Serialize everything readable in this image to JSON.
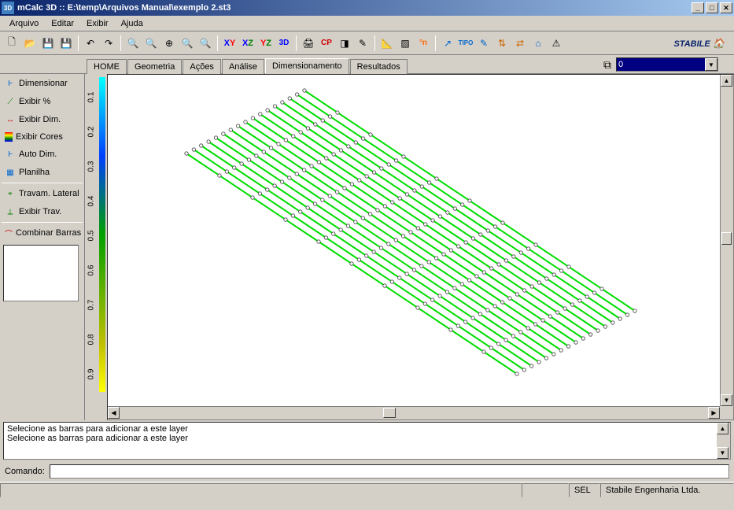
{
  "title": "mCalc 3D :: E:\\temp\\Arquivos Manual\\exemplo 2.st3",
  "menu": {
    "arquivo": "Arquivo",
    "editar": "Editar",
    "exibir": "Exibir",
    "ajuda": "Ajuda"
  },
  "view_buttons": {
    "xy": "XY",
    "xz": "XZ",
    "yz": "YZ",
    "3d": "3D",
    "cp": "CP",
    "n": "°n",
    "tipo": "TIPO"
  },
  "brand": "STABILE",
  "tabs": {
    "home": "HOME",
    "geometria": "Geometria",
    "acoes": "Ações",
    "analise": "Análise",
    "dimensionamento": "Dimensionamento",
    "resultados": "Resultados"
  },
  "combo_value": "0",
  "sidebar": {
    "dimensionar": "Dimensionar",
    "exibir_pct": "Exibir %",
    "exibir_dim": "Exibir Dim.",
    "exibir_cores": "Exibir Cores",
    "auto_dim": "Auto Dim.",
    "planilha": "Planilha",
    "travam_lateral": "Travam. Lateral",
    "exibir_trav": "Exibir Trav.",
    "combinar_barras": "Combinar Barras"
  },
  "colorbar_ticks": [
    "0.1",
    "0.2",
    "0.3",
    "0.4",
    "0.5",
    "0.6",
    "0.7",
    "0.8",
    "0.9"
  ],
  "log": {
    "line1": "Selecione as barras para adicionar a este layer",
    "line2": "Selecione as barras para adicionar a este layer"
  },
  "command_label": "Comando:",
  "status": {
    "sel": "SEL",
    "company": "Stabile Engenharia Ltda."
  },
  "chart_data": {
    "type": "3d-structure",
    "description": "Isometric view of a planar structural grid",
    "line_count_horizontal": 17,
    "nodes_per_line": 11,
    "color": "#00dd00",
    "colorbar_range": [
      0.1,
      0.9
    ]
  }
}
